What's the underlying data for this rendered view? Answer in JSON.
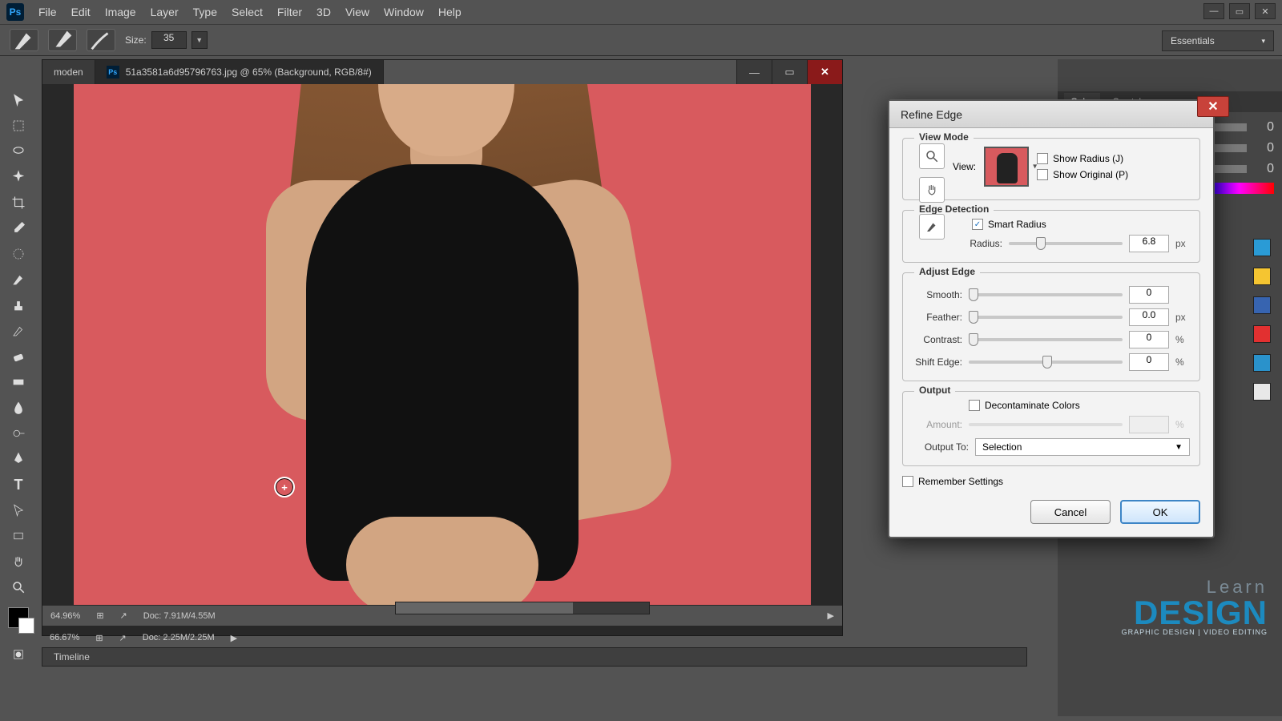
{
  "menu": {
    "items": [
      "File",
      "Edit",
      "Image",
      "Layer",
      "Type",
      "Select",
      "Filter",
      "3D",
      "View",
      "Window",
      "Help"
    ]
  },
  "optbar": {
    "size_label": "Size:",
    "size_value": "35"
  },
  "workspace": {
    "label": "Essentials"
  },
  "doc": {
    "tab_extra": "moden",
    "title": "51a3581a6d95796763.jpg @ 65% (Background, RGB/8#)",
    "status_zoom": "64.96%",
    "status_doc": "Doc: 7.91M/4.55M"
  },
  "appstatus": {
    "zoom": "66.67%",
    "doc": "Doc: 2.25M/2.25M"
  },
  "timeline": {
    "label": "Timeline"
  },
  "panels": {
    "color_tab": "Color",
    "swatches_tab": "Swatches"
  },
  "dialog": {
    "title": "Refine Edge",
    "viewmode": {
      "legend": "View Mode",
      "view_label": "View:",
      "show_radius": "Show Radius (J)",
      "show_original": "Show Original (P)"
    },
    "edge": {
      "legend": "Edge Detection",
      "smart_radius": "Smart Radius",
      "radius_label": "Radius:",
      "radius_value": "6.8",
      "radius_unit": "px"
    },
    "adjust": {
      "legend": "Adjust Edge",
      "smooth_label": "Smooth:",
      "smooth_value": "0",
      "feather_label": "Feather:",
      "feather_value": "0.0",
      "feather_unit": "px",
      "contrast_label": "Contrast:",
      "contrast_value": "0",
      "contrast_unit": "%",
      "shift_label": "Shift Edge:",
      "shift_value": "0",
      "shift_unit": "%"
    },
    "output": {
      "legend": "Output",
      "decontaminate": "Decontaminate Colors",
      "amount_label": "Amount:",
      "amount_unit": "%",
      "outputto_label": "Output To:",
      "outputto_value": "Selection"
    },
    "remember": "Remember Settings",
    "cancel": "Cancel",
    "ok": "OK"
  },
  "swatches": [
    "#2a9bd6",
    "#f5c531",
    "#3764b0",
    "#e23030",
    "#2a92cb",
    "#e8e8e8"
  ],
  "watermark": {
    "l1": "Learn",
    "l2": "DESIGN",
    "l3": "GRAPHIC DESIGN | VIDEO EDITING"
  }
}
